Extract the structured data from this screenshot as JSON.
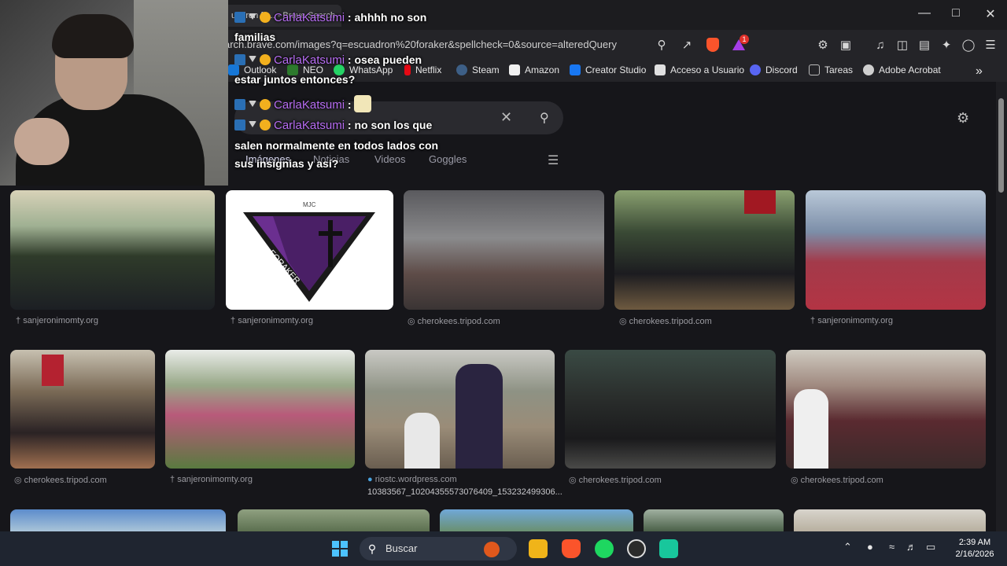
{
  "browser": {
    "tab_title": "uadron fo... - Brave Search",
    "url": "arch.brave.com/images?q=escuadron%20foraker&spellcheck=0&source=alteredQuery",
    "window_controls": [
      "minimize",
      "maximize",
      "close"
    ],
    "extension_badge": "1"
  },
  "bookmarks": [
    {
      "label": "Outlook",
      "color": "#1677d8"
    },
    {
      "label": "NEO",
      "color": "#2d7a2d"
    },
    {
      "label": "WhatsApp",
      "color": "#25d366"
    },
    {
      "label": "Netflix",
      "color": "#e50914"
    },
    {
      "label": "Steam",
      "color": "#1b2838"
    },
    {
      "label": "Amazon",
      "color": "#ff9900"
    },
    {
      "label": "Creator Studio",
      "color": "#1877f2"
    },
    {
      "label": "Acceso a Usuario",
      "color": "#e0e0e0"
    },
    {
      "label": "Discord",
      "color": "#5865f2"
    },
    {
      "label": "Tareas",
      "color": "#9a9a9a"
    },
    {
      "label": "Adobe Acrobat",
      "color": "#cfcfcf"
    }
  ],
  "search": {
    "tabs": [
      "Imágenes",
      "Noticias",
      "Videos",
      "Goggles"
    ],
    "active_tab": "Imágenes"
  },
  "results": {
    "row1": [
      {
        "source": "sanjeronimomty.org"
      },
      {
        "source": "sanjeronimomty.org",
        "logo_text": "MJC",
        "logo_word": "FORAKER"
      },
      {
        "source": "cherokees.tripod.com"
      },
      {
        "source": "cherokees.tripod.com"
      },
      {
        "source": "sanjeronimomty.org"
      }
    ],
    "row2": [
      {
        "source": "cherokees.tripod.com"
      },
      {
        "source": "sanjeronimomty.org"
      },
      {
        "source": "riostc.wordpress.com",
        "caption": "10383567_10204355573076409_153232499306..."
      },
      {
        "source": "cherokees.tripod.com"
      },
      {
        "source": "cherokees.tripod.com"
      }
    ]
  },
  "chat": [
    {
      "user": "CarlaKatsumi",
      "message": "ahhhh no son",
      "cont": "familias"
    },
    {
      "user": "CarlaKatsumi",
      "message": "osea pueden",
      "cont": "estar juntos entonces?"
    },
    {
      "user": "CarlaKatsumi",
      "message": "",
      "emote": true
    },
    {
      "user": "CarlaKatsumi",
      "message": "no son los que",
      "cont": "salen normalmente en todos lados con",
      "cont2": "sus insignias y así?"
    }
  ],
  "taskbar": {
    "search_placeholder": "Buscar",
    "time": "2:39 AM",
    "date": "2/16/2026"
  }
}
